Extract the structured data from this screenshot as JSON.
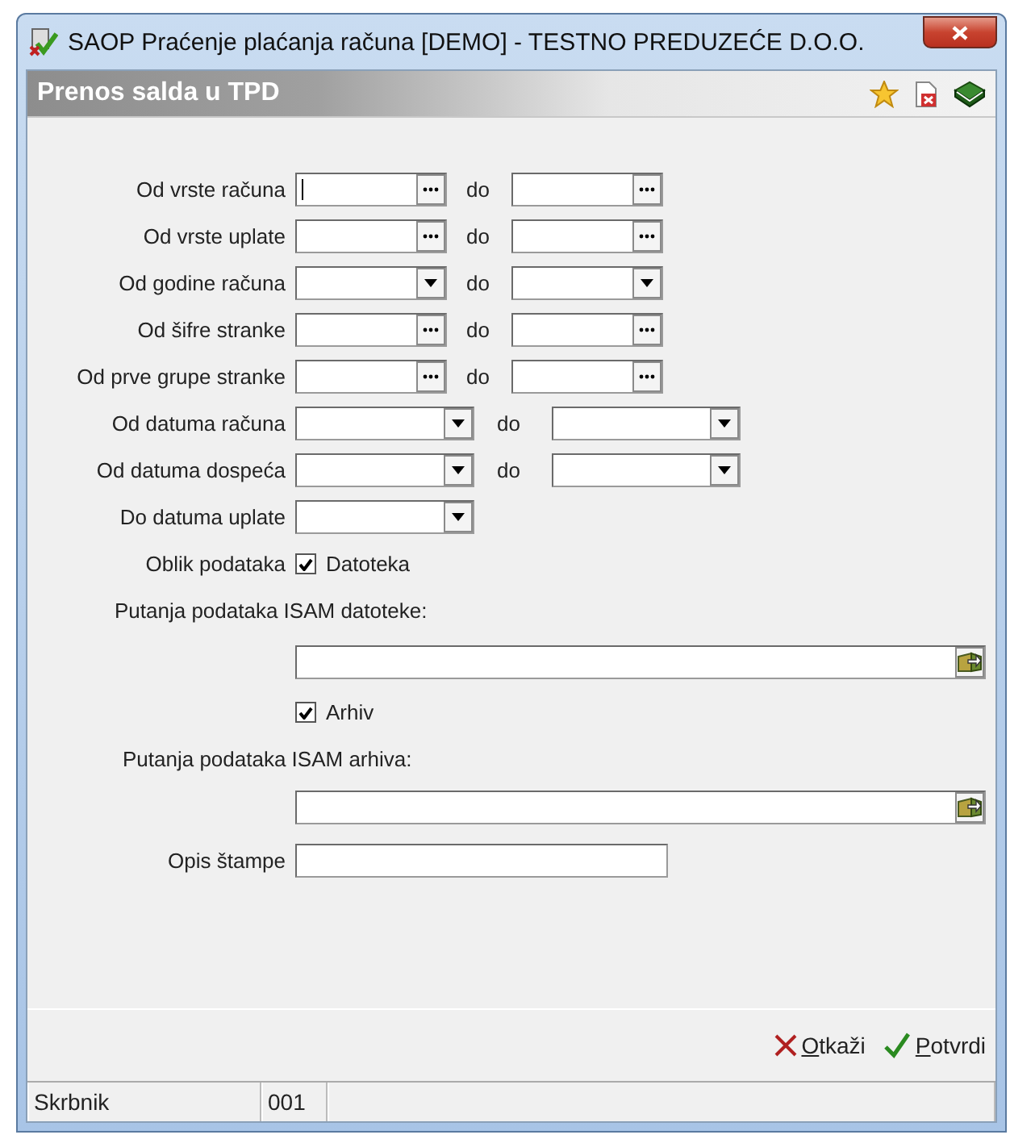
{
  "window": {
    "title": "SAOP Praćenje plaćanja računa [DEMO] - TESTNO PREDUZEĆE D.O.O."
  },
  "panel": {
    "title": "Prenos salda u TPD"
  },
  "filters": [
    {
      "label": "Od vrste računa",
      "kind": "lookup",
      "to_label": "do",
      "focused": true
    },
    {
      "label": "Od vrste uplate",
      "kind": "lookup",
      "to_label": "do",
      "focused": false
    },
    {
      "label": "Od godine računa",
      "kind": "dropdown",
      "to_label": "do",
      "focused": false
    },
    {
      "label": "Od šifre stranke",
      "kind": "lookup",
      "to_label": "do",
      "focused": false
    },
    {
      "label": "Od prve grupe stranke",
      "kind": "lookup",
      "to_label": "do",
      "focused": false
    },
    {
      "label": "Od datuma računa",
      "kind": "date",
      "to_label": "do",
      "focused": false
    },
    {
      "label": "Od datuma dospeća",
      "kind": "date",
      "to_label": "do",
      "focused": false
    },
    {
      "label": "Do datuma uplate",
      "kind": "date",
      "focused": false
    }
  ],
  "data_form": {
    "label": "Oblik podataka",
    "checkbox": {
      "label": "Datoteka",
      "checked": true
    }
  },
  "isam_file_path": {
    "label": "Putanja podataka ISAM datoteke:"
  },
  "archive": {
    "label": "Arhiv",
    "checked": true
  },
  "isam_archive_path": {
    "label": "Putanja podataka ISAM arhiva:"
  },
  "print_description": {
    "label": "Opis štampe"
  },
  "buttons": [
    {
      "label": "Otkaži",
      "kind": "cancel"
    },
    {
      "label": "Potvrdi",
      "kind": "confirm"
    }
  ],
  "status_bar": [
    "Skrbnik",
    "001"
  ]
}
